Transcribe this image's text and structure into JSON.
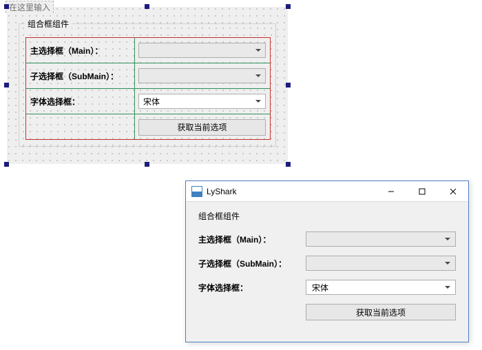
{
  "designer": {
    "caption": "在这里输入",
    "groupbox_title": "组合框组件",
    "rows": {
      "main": {
        "label": "主选择框（Main）：",
        "value": ""
      },
      "submain": {
        "label": "子选择框（SubMain）：",
        "value": ""
      },
      "font": {
        "label": "字体选择框：",
        "value": "宋体"
      }
    },
    "button_label": "获取当前选项"
  },
  "runtime": {
    "title": "LyShark",
    "groupbox_title": "组合框组件",
    "rows": {
      "main": {
        "label": "主选择框（Main）：",
        "value": ""
      },
      "submain": {
        "label": "子选择框（SubMain）：",
        "value": ""
      },
      "font": {
        "label": "字体选择框：",
        "value": "宋体"
      }
    },
    "button_label": "获取当前选项"
  }
}
